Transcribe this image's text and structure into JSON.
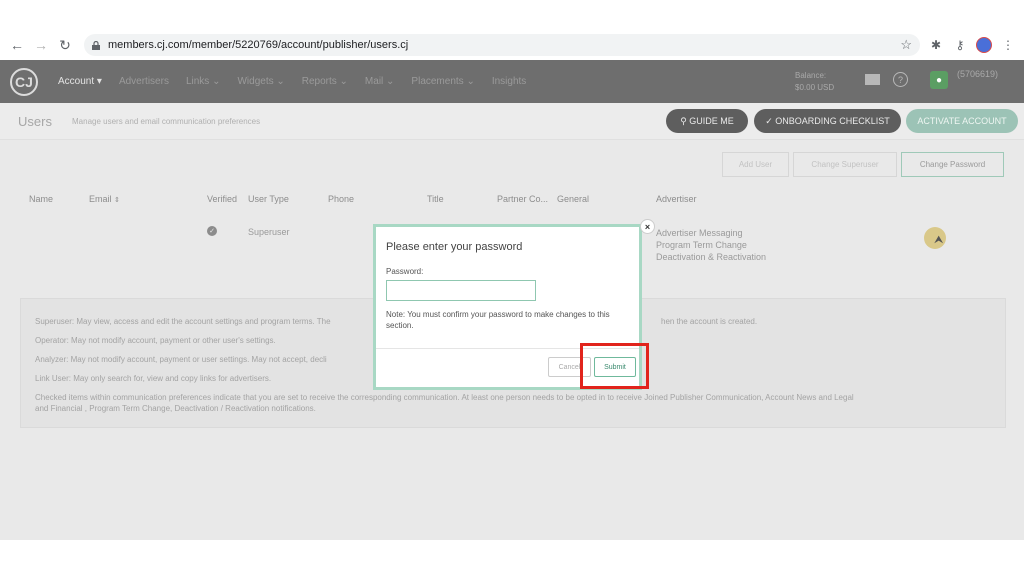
{
  "browser": {
    "url": "members.cj.com/member/5220769/account/publisher/users.cj"
  },
  "topnav": {
    "items": [
      {
        "label": "Account ▾",
        "active": true
      },
      {
        "label": "Advertisers"
      },
      {
        "label": "Links ⌄"
      },
      {
        "label": "Widgets ⌄"
      },
      {
        "label": "Reports ⌄"
      },
      {
        "label": "Mail ⌄"
      },
      {
        "label": "Placements ⌄"
      },
      {
        "label": "Insights"
      }
    ],
    "balance_label": "Balance:",
    "balance_value": "$0.00 USD",
    "account_id": "(5706619)"
  },
  "subheader": {
    "title": "Users",
    "subtitle": "Manage users and email communication preferences",
    "guide_me": "GUIDE ME",
    "onboarding": "ONBOARDING CHECKLIST",
    "activate": "ACTIVATE ACCOUNT"
  },
  "user_buttons": {
    "add": "Add User",
    "change_superuser": "Change Superuser",
    "change_password": "Change Password"
  },
  "table": {
    "headers": [
      "Name",
      "Email",
      "Verified",
      "User Type",
      "Phone",
      "Title",
      "Partner Co...",
      "General",
      "Advertiser"
    ],
    "row": {
      "user_type": "Superuser",
      "advertiser_lines": [
        "Advertiser Messaging",
        "Program Term Change",
        "Deactivation & Reactivation"
      ]
    }
  },
  "info": {
    "lines": [
      "Superuser: May view, access and edit the account settings and program terms. The",
      "hen the account is created.",
      "Operator: May not modify account, payment or other user's settings.",
      "Analyzer: May not modify account, payment or user settings. May not accept, decli",
      "Link User: May only search for, view and copy links for advertisers.",
      "Checked items within communication preferences indicate that you are set to receive the corresponding communication. At least one person needs to be opted in to receive Joined Publisher Communication, Account News and Legal",
      "and Financial , Program Term Change, Deactivation / Reactivation notifications."
    ]
  },
  "modal": {
    "title": "Please enter your password",
    "password_label": "Password:",
    "password_value": "",
    "note": "Note: You must confirm your password to make changes to this section.",
    "cancel": "Cancel",
    "submit": "Submit",
    "close": "×"
  },
  "colors": {
    "highlight": "#e1241c",
    "modal_border": "#a8d8c4",
    "accent_green": "#3a8a6e"
  }
}
